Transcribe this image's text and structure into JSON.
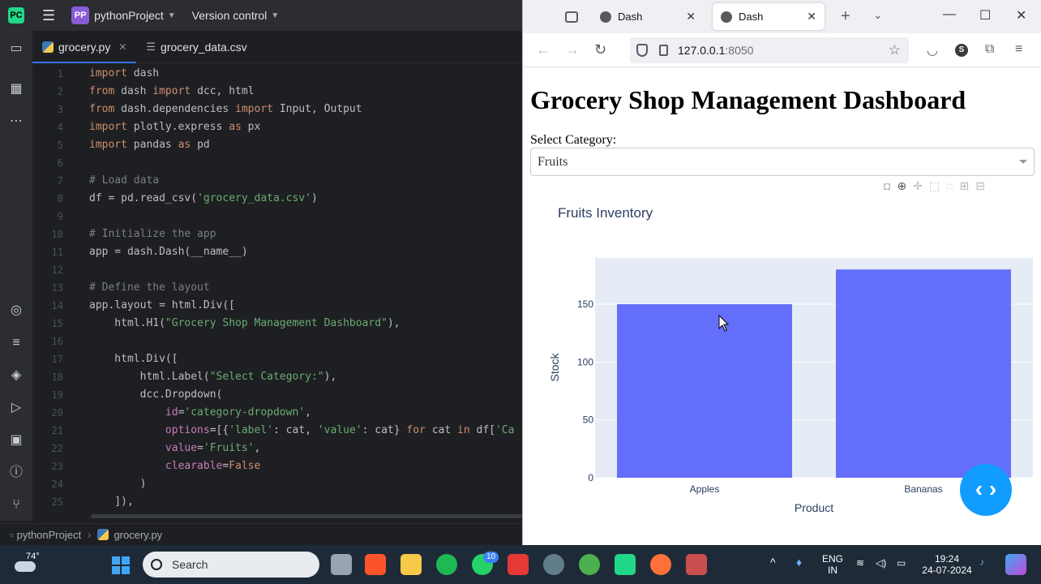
{
  "ide": {
    "logo": "PC",
    "project_badge": "PP",
    "project_name": "pythonProject",
    "version_control": "Version control",
    "tabs": [
      {
        "label": "grocery.py",
        "active": true
      },
      {
        "label": "grocery_data.csv",
        "active": false
      }
    ],
    "breadcrumb": {
      "project": "pythonProject",
      "file": "grocery.py"
    },
    "code_lines": [
      {
        "n": "1"
      },
      {
        "n": "2"
      },
      {
        "n": "3"
      },
      {
        "n": "4"
      },
      {
        "n": "5"
      },
      {
        "n": "6"
      },
      {
        "n": "7"
      },
      {
        "n": "8"
      },
      {
        "n": "9"
      },
      {
        "n": "10"
      },
      {
        "n": "11"
      },
      {
        "n": "12"
      },
      {
        "n": "13"
      },
      {
        "n": "14"
      },
      {
        "n": "15"
      },
      {
        "n": "16"
      },
      {
        "n": "17"
      },
      {
        "n": "18"
      },
      {
        "n": "19"
      },
      {
        "n": "20"
      },
      {
        "n": "21"
      },
      {
        "n": "22"
      },
      {
        "n": "23"
      },
      {
        "n": "24"
      },
      {
        "n": "25"
      }
    ],
    "code": {
      "l1": [
        "import",
        " dash"
      ],
      "l2": [
        "from",
        " dash ",
        "import",
        " dcc, html"
      ],
      "l3": [
        "from",
        " dash.dependencies ",
        "import",
        " Input, Output"
      ],
      "l4": [
        "import",
        " plotly.express ",
        "as",
        " px"
      ],
      "l5": [
        "import",
        " pandas ",
        "as",
        " pd"
      ],
      "l7": "# Load data",
      "l8": [
        "df = pd.read_csv(",
        "'grocery_data.csv'",
        ")"
      ],
      "l10": "# Initialize the app",
      "l11": "app = dash.Dash(__name__)",
      "l13": "# Define the layout",
      "l14": "app.layout = html.Div([",
      "l15": [
        "    html.H1(",
        "\"Grocery Shop Management Dashboard\"",
        "),"
      ],
      "l17": "    html.Div([",
      "l18": [
        "        html.Label(",
        "\"Select Category:\"",
        "),"
      ],
      "l19": "        dcc.Dropdown(",
      "l20": [
        "            ",
        "id",
        "=",
        "'category-dropdown'",
        ","
      ],
      "l21": [
        "            ",
        "options",
        "=[{",
        "'label'",
        ": cat, ",
        "'value'",
        ": cat} ",
        "for",
        " cat ",
        "in",
        " df[",
        "'Ca"
      ],
      "l22": [
        "            ",
        "value",
        "=",
        "'Fruits'",
        ","
      ],
      "l23": [
        "            ",
        "clearable",
        "=",
        "False"
      ],
      "l24": "        )",
      "l25": "    ]),"
    }
  },
  "browser": {
    "tabs": [
      {
        "label": "Dash",
        "active": false
      },
      {
        "label": "Dash",
        "active": true
      }
    ],
    "url_host": "127.0.0.1",
    "url_port": ":8050",
    "avatar_letter": "S"
  },
  "dashboard": {
    "title": "Grocery Shop Management Dashboard",
    "select_label": "Select Category:",
    "dropdown_value": "Fruits"
  },
  "chart_data": {
    "type": "bar",
    "title": "Fruits Inventory",
    "xlabel": "Product",
    "ylabel": "Stock",
    "categories": [
      "Apples",
      "Bananas"
    ],
    "values": [
      150,
      180
    ],
    "ylim": [
      0,
      190
    ],
    "yticks": [
      0,
      50,
      100,
      150
    ],
    "bar_color": "#636efa",
    "plot_bg": "#e5ecf6",
    "grid": true
  },
  "taskbar": {
    "weather_temp": "74°",
    "search_placeholder": "Search",
    "badge_count": "10",
    "lang_top": "ENG",
    "lang_bottom": "IN",
    "time": "19:24",
    "date": "24-07-2024"
  }
}
